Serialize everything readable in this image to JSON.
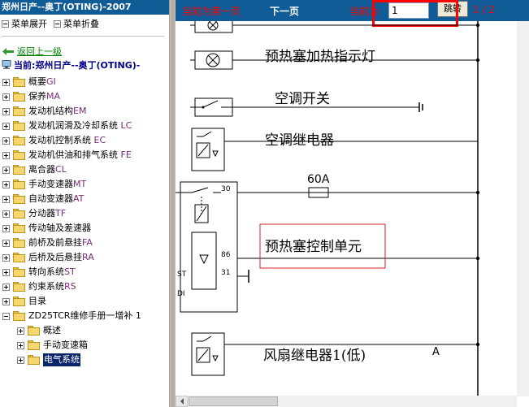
{
  "app": {
    "title": "郑州日产--奥丁(OTING)-2007"
  },
  "menu": {
    "expand": "菜单展开",
    "collapse": "菜单折叠"
  },
  "nav": {
    "back": "返回上一级",
    "current": "当前:郑州日产--奥丁(OTING)-"
  },
  "tree": [
    {
      "label": "概要",
      "suffix": "GI"
    },
    {
      "label": "保养",
      "suffix": "MA"
    },
    {
      "label": "发动机结构",
      "suffix": "EM"
    },
    {
      "label": "发动机润滑及冷却系统 ",
      "suffix": "LC"
    },
    {
      "label": "发动机控制系统 ",
      "suffix": "EC"
    },
    {
      "label": "发动机供油和排气系统 ",
      "suffix": "FE"
    },
    {
      "label": "离合器",
      "suffix": "CL"
    },
    {
      "label": "手动变速器",
      "suffix": "MT"
    },
    {
      "label": "自动变速器",
      "suffix": "AT"
    },
    {
      "label": "分动器",
      "suffix": "TF"
    },
    {
      "label": "传动轴及差速器",
      "suffix": ""
    },
    {
      "label": "前桥及前悬挂",
      "suffix": "FA"
    },
    {
      "label": "后桥及后悬挂",
      "suffix": "RA"
    },
    {
      "label": "转向系统",
      "suffix": "ST"
    },
    {
      "label": "约束系统",
      "suffix": "RS"
    },
    {
      "label": "目录",
      "suffix": ""
    },
    {
      "label": "ZD25TCR维修手册一增补 1",
      "suffix": ""
    },
    {
      "label": "概述",
      "suffix": ""
    },
    {
      "label": "手动变速箱",
      "suffix": ""
    },
    {
      "label": "电气系统",
      "suffix": ""
    }
  ],
  "toolbar": {
    "first": "当前为第一页",
    "next": "下一页",
    "current_label": "当前为",
    "page_value": "1",
    "jump": "跳转",
    "count": "1 / 2"
  },
  "diagram": {
    "labels": {
      "glow_lamp": "预热塞加热指示灯",
      "ac_switch": "空调开关",
      "ac_relay": "空调继电器",
      "fuse": "60A",
      "glow_unit": "预热塞控制单元",
      "fan_relay": "风扇继电器1(低)",
      "mark_a": "A",
      "pin30": "30",
      "pin86": "86",
      "pin31": "31",
      "st": "ST",
      "di": "DI"
    }
  },
  "colors": {
    "title_bar": "#0f5c96",
    "highlight_box": "#ff0000",
    "selected": "#0a246a"
  }
}
